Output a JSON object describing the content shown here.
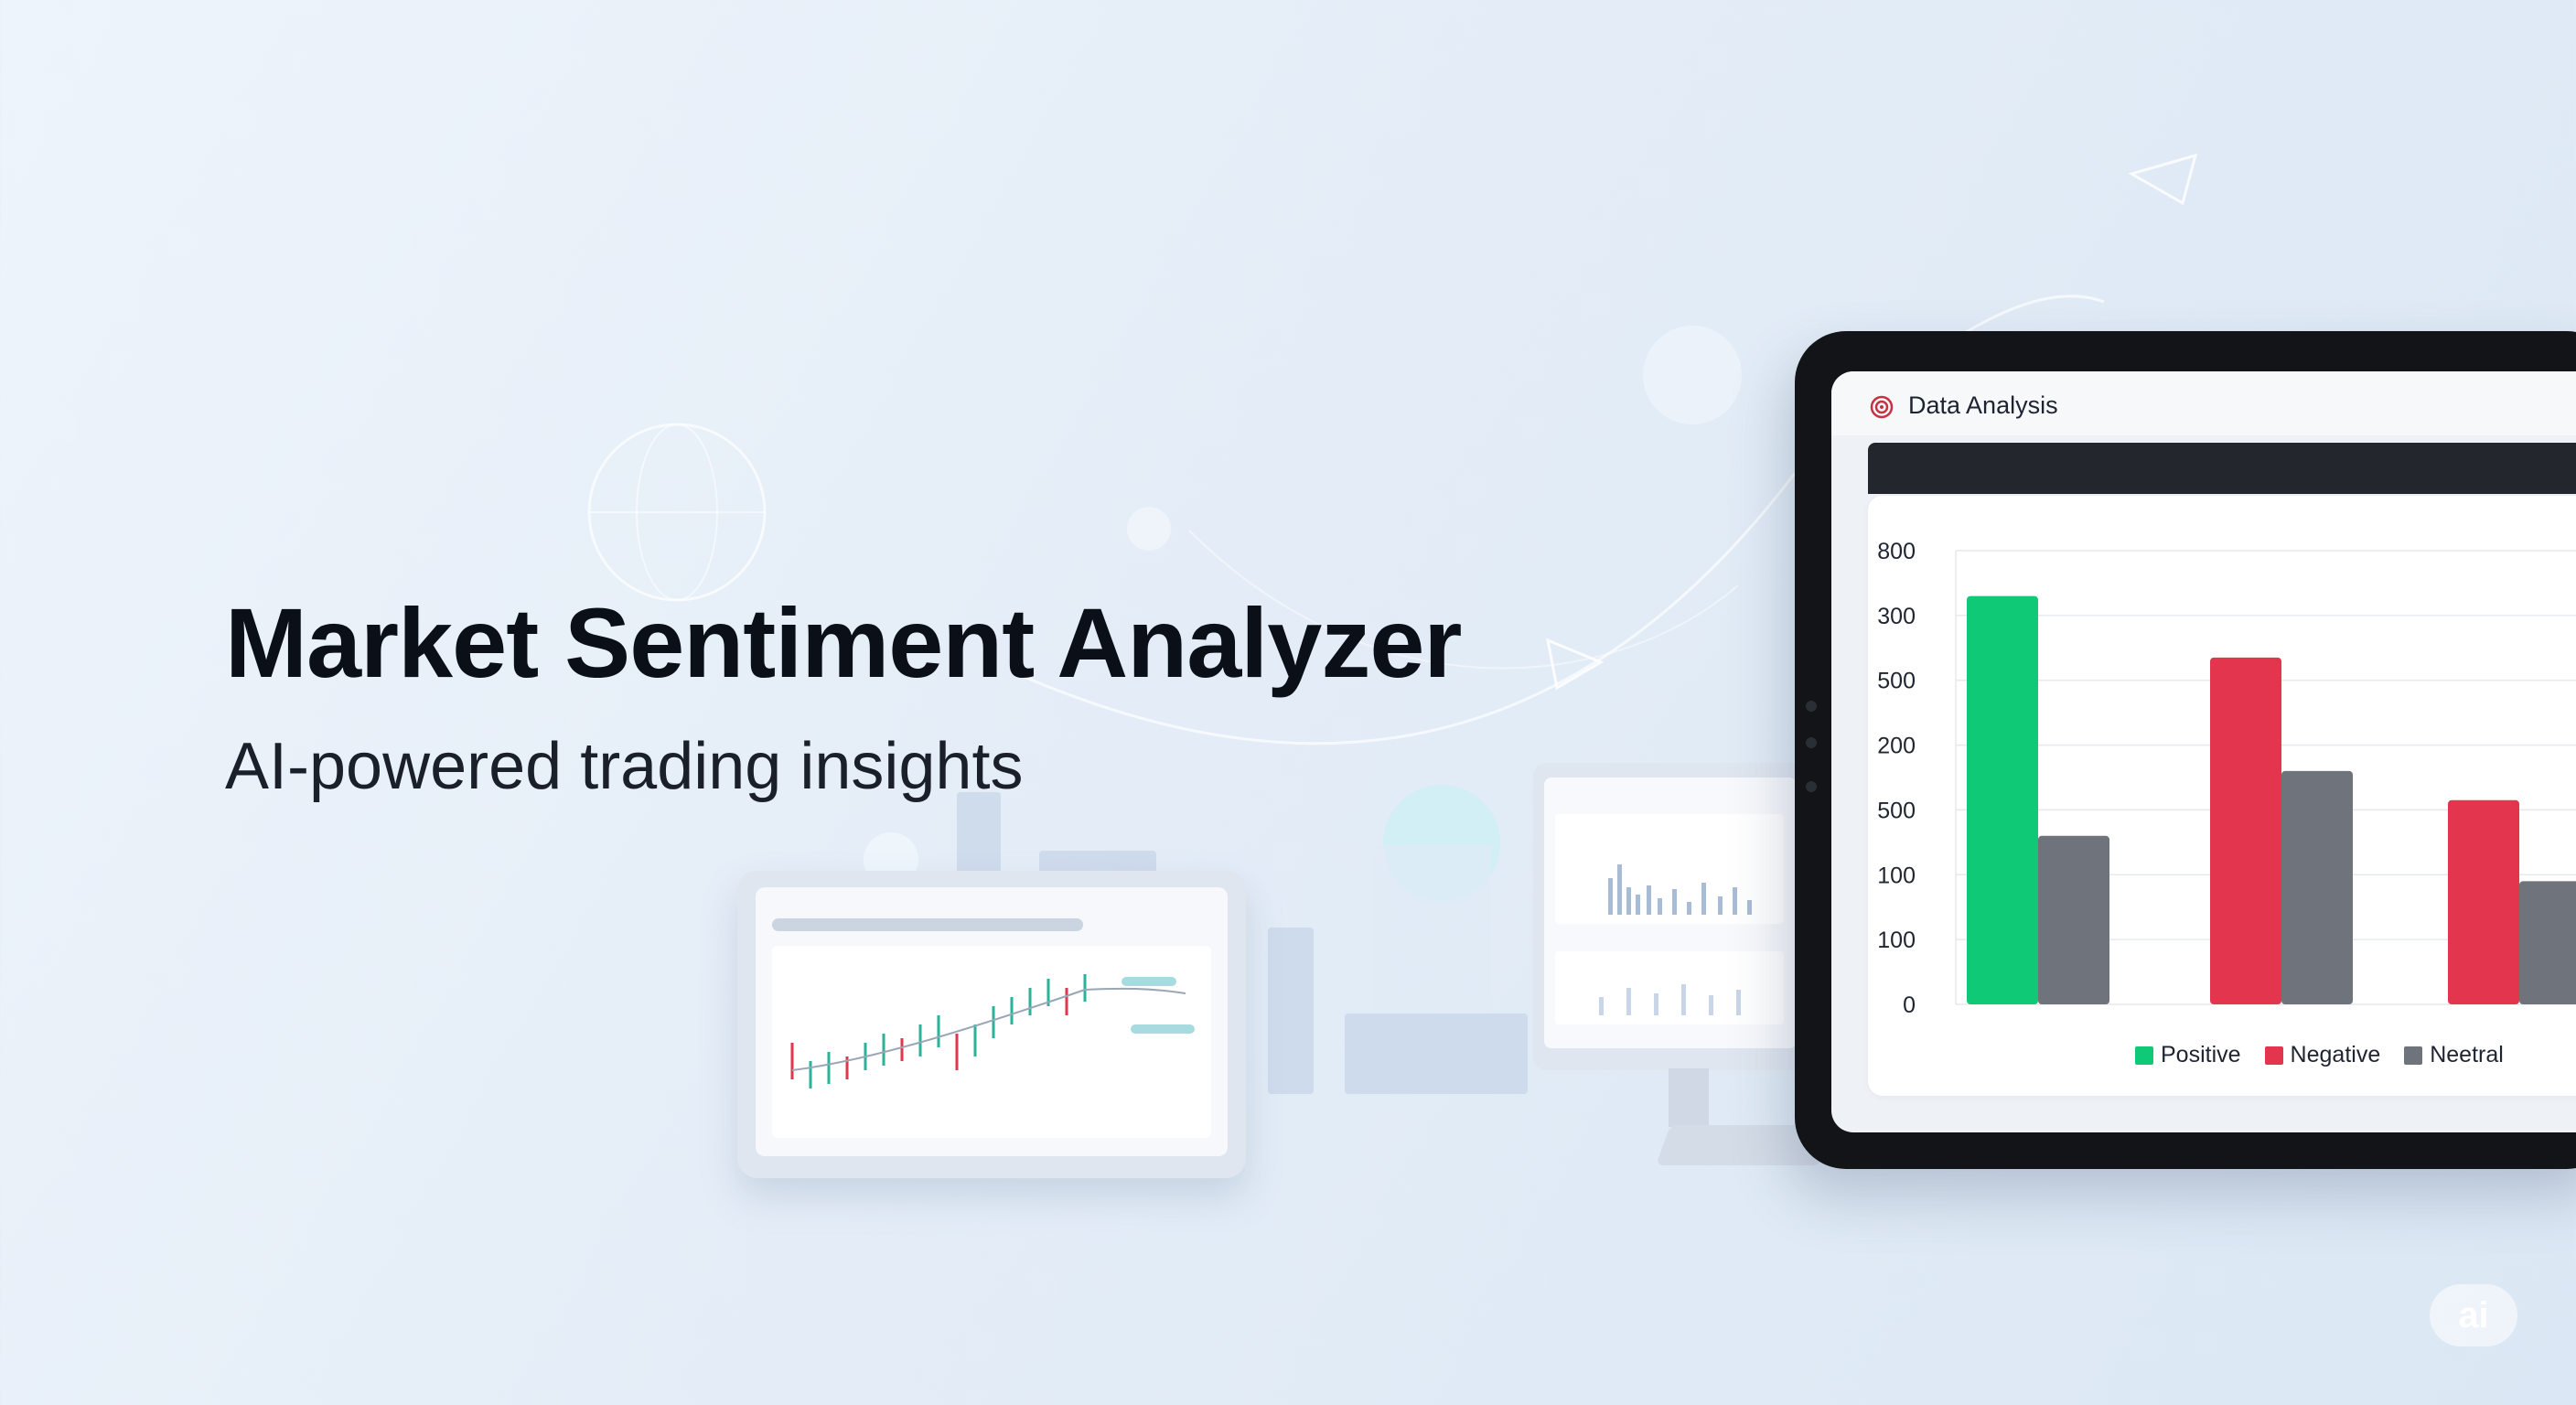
{
  "hero": {
    "title": "Market Sentiment Analyzer",
    "subtitle": "AI-powered trading insights"
  },
  "app": {
    "title": "Data Analysis",
    "logo_icon": "target-icon"
  },
  "colors": {
    "positive": "#0fc977",
    "negative": "#e3364e",
    "neutral": "#6e737c"
  },
  "chart_data": {
    "type": "bar",
    "title": "",
    "xlabel": "",
    "ylabel": "",
    "y_tick_labels": [
      "800",
      "300",
      "500",
      "200",
      "500",
      "100",
      "100",
      "0"
    ],
    "ylim": [
      0,
      700
    ],
    "categories": [
      "",
      "",
      ""
    ],
    "series": [
      {
        "name": "Positive",
        "color": "#0fc977",
        "values": [
          630,
          null,
          null
        ]
      },
      {
        "name": "Negative",
        "color": "#e3364e",
        "values": [
          null,
          535,
          315
        ]
      },
      {
        "name": "Neetral",
        "color": "#6e737c",
        "values": [
          260,
          360,
          190
        ]
      }
    ],
    "legend": "bottom",
    "grid": true
  },
  "badge": {
    "label": "ai"
  }
}
